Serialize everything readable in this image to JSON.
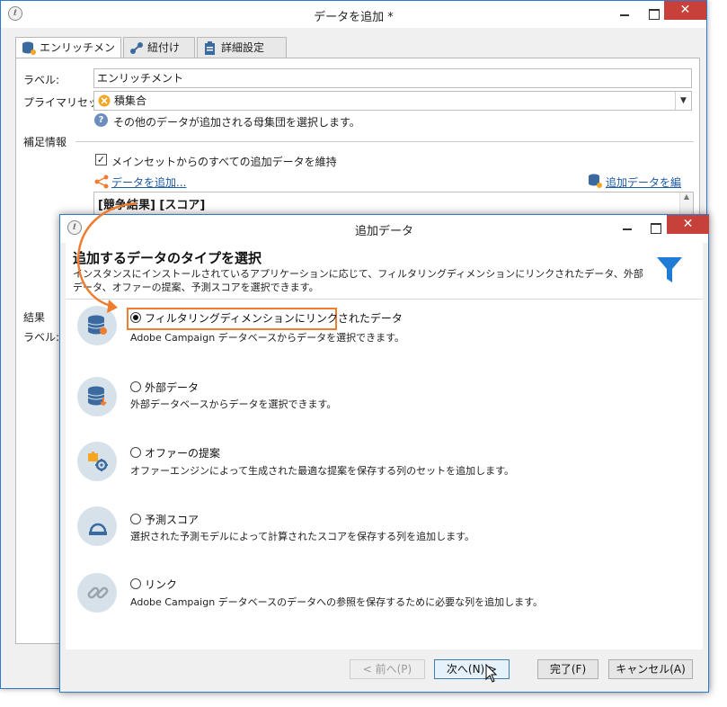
{
  "back_window": {
    "title": "データを追加 *",
    "app_icon": "app-icon",
    "tabs": [
      {
        "label": "エンリッチメント",
        "icon": "database-star-icon"
      },
      {
        "label": "紐付け",
        "icon": "link-icon"
      },
      {
        "label": "詳細設定",
        "icon": "clipboard-icon"
      }
    ],
    "label_caption": "ラベル:",
    "label_value": "エンリッチメント",
    "primary_set_caption": "プライマリセット:",
    "primary_set_value": "積集合",
    "help_text": "その他のデータが追加される母集団を選択します。",
    "supplement_header": "補足情報",
    "keep_checkbox_label": "メインセットからのすべての追加データを維持",
    "keep_checkbox_checked": true,
    "add_data_link": "データを追加...",
    "edit_data_link": "追加データを編集...",
    "expression": "[競争結果] [スコア]",
    "result_header": "結果",
    "result_label_caption": "ラベル:"
  },
  "dialog": {
    "title": "追加データ",
    "heading": "追加するデータのタイプを選択",
    "description": "インスタンスにインストールされているアプリケーションに応じて、フィルタリングディメンションにリンクされたデータ、外部データ、オファーの提案、予測スコアを選択できます。",
    "header_icon": "funnel-icon",
    "options": [
      {
        "label": "フィルタリングディメンションにリンクされたデータ",
        "description": "Adobe Campaign データベースからデータを選択できます。",
        "icon": "database-linked-icon",
        "selected": true
      },
      {
        "label": "外部データ",
        "description": "外部データベースからデータを選択できます。",
        "icon": "external-database-icon",
        "selected": false
      },
      {
        "label": "オファーの提案",
        "description": "オファーエンジンによって生成された最適な提案を保存する列のセットを追加します。",
        "icon": "offer-gear-icon",
        "selected": false
      },
      {
        "label": "予測スコア",
        "description": "選択された予測モデルによって計算されたスコアを保存する列を追加します。",
        "icon": "predictive-score-icon",
        "selected": false
      },
      {
        "label": "リンク",
        "description": "Adobe Campaign データベースのデータへの参照を保存するために必要な列を追加します。",
        "icon": "link-chain-icon",
        "selected": false
      }
    ],
    "buttons": {
      "prev": "< 前へ(P)",
      "next": "次へ(N) >",
      "finish": "完了(F)",
      "cancel": "キャンセル(A)"
    }
  },
  "colors": {
    "accent_orange": "#f07c2e",
    "close_red": "#c7403a",
    "link_blue": "#1c5aa6",
    "funnel_blue": "#1e7bd6"
  }
}
